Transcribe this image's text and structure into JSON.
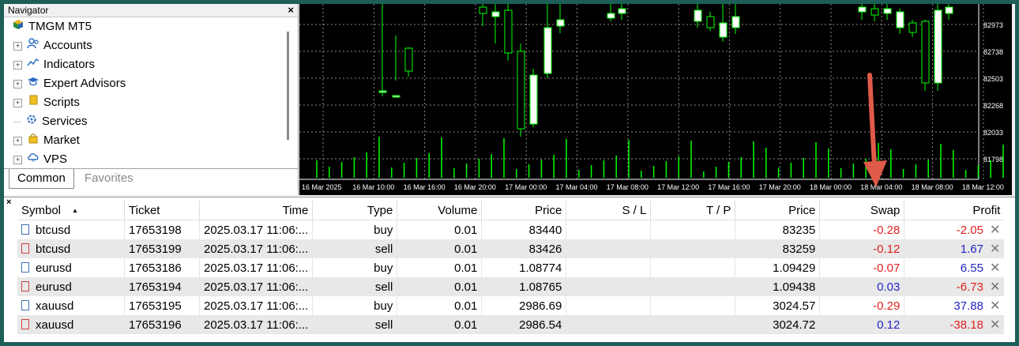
{
  "navigator": {
    "title": "Navigator",
    "close": "×",
    "root": "TMGM MT5",
    "items": [
      {
        "label": "Accounts",
        "icon": "accounts-icon"
      },
      {
        "label": "Indicators",
        "icon": "indicators-icon"
      },
      {
        "label": "Expert Advisors",
        "icon": "expert-advisors-icon"
      },
      {
        "label": "Scripts",
        "icon": "scripts-icon"
      },
      {
        "label": "Services",
        "icon": "services-icon"
      },
      {
        "label": "Market",
        "icon": "market-icon"
      },
      {
        "label": "VPS",
        "icon": "vps-icon"
      }
    ],
    "tabs": [
      "Common",
      "Favorites"
    ]
  },
  "chart": {
    "price_labels": [
      "82973",
      "82738",
      "82503",
      "82268",
      "82033",
      "81798"
    ],
    "time_labels": [
      "16 Mar 2025",
      "16 Mar 10:00",
      "16 Mar 16:00",
      "16 Mar 20:00",
      "17 Mar 00:00",
      "17 Mar 04:00",
      "17 Mar 08:00",
      "17 Mar 12:00",
      "17 Mar 16:00",
      "17 Mar 20:00",
      "18 Mar 00:00",
      "18 Mar 04:00",
      "18 Mar 08:00",
      "18 Mar 12:00"
    ],
    "colors": {
      "background": "#000000",
      "candle": "#00ff00",
      "bull_body": "#ffffff",
      "grid": "#8a8a8a",
      "arrow": "#e05a4a"
    }
  },
  "toolbox": {
    "close": "×",
    "columns": [
      "Symbol",
      "Ticket",
      "Time",
      "Type",
      "Volume",
      "Price",
      "S / L",
      "T / P",
      "Price",
      "Swap",
      "Profit"
    ],
    "sort_indicator": "▲",
    "rows": [
      {
        "symbol": "btcusd",
        "ticket": "17653198",
        "time": "2025.03.17 11:06:...",
        "type": "buy",
        "volume": "0.01",
        "price": "83440",
        "sl": "",
        "tp": "",
        "cur_price": "83235",
        "swap": "-0.28",
        "profit": "-2.05",
        "close": "✕"
      },
      {
        "symbol": "btcusd",
        "ticket": "17653199",
        "time": "2025.03.17 11:06:...",
        "type": "sell",
        "volume": "0.01",
        "price": "83426",
        "sl": "",
        "tp": "",
        "cur_price": "83259",
        "swap": "-0.12",
        "profit": "1.67",
        "close": "✕"
      },
      {
        "symbol": "eurusd",
        "ticket": "17653186",
        "time": "2025.03.17 11:06:...",
        "type": "buy",
        "volume": "0.01",
        "price": "1.08774",
        "sl": "",
        "tp": "",
        "cur_price": "1.09429",
        "swap": "-0.07",
        "profit": "6.55",
        "close": "✕"
      },
      {
        "symbol": "eurusd",
        "ticket": "17653194",
        "time": "2025.03.17 11:06:...",
        "type": "sell",
        "volume": "0.01",
        "price": "1.08765",
        "sl": "",
        "tp": "",
        "cur_price": "1.09438",
        "swap": "0.03",
        "profit": "-6.73",
        "close": "✕"
      },
      {
        "symbol": "xauusd",
        "ticket": "17653195",
        "time": "2025.03.17 11:06:...",
        "type": "buy",
        "volume": "0.01",
        "price": "2986.69",
        "sl": "",
        "tp": "",
        "cur_price": "3024.57",
        "swap": "-0.29",
        "profit": "37.88",
        "close": "✕"
      },
      {
        "symbol": "xauusd",
        "ticket": "17653196",
        "time": "2025.03.17 11:06:...",
        "type": "sell",
        "volume": "0.01",
        "price": "2986.54",
        "sl": "",
        "tp": "",
        "cur_price": "3024.72",
        "swap": "0.12",
        "profit": "-38.18",
        "close": "✕"
      }
    ]
  }
}
